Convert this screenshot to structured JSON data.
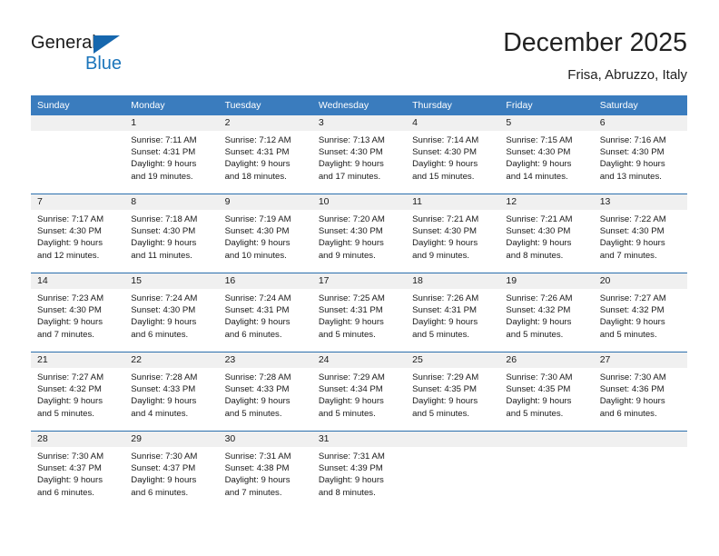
{
  "brand": {
    "name_part1": "General",
    "name_part2": "Blue",
    "triangle_color": "#1667ae",
    "blue_color": "#1b75bb"
  },
  "header": {
    "title": "December 2025",
    "subtitle": "Frisa, Abruzzo, Italy",
    "accent_color": "#3a7cbe",
    "separator_color": "#2a6ead",
    "daynum_band_color": "#f0f0f0"
  },
  "weekdays": [
    "Sunday",
    "Monday",
    "Tuesday",
    "Wednesday",
    "Thursday",
    "Friday",
    "Saturday"
  ],
  "weeks": [
    [
      {
        "day": "",
        "lines": []
      },
      {
        "day": "1",
        "lines": [
          "Sunrise: 7:11 AM",
          "Sunset: 4:31 PM",
          "Daylight: 9 hours",
          "and 19 minutes."
        ]
      },
      {
        "day": "2",
        "lines": [
          "Sunrise: 7:12 AM",
          "Sunset: 4:31 PM",
          "Daylight: 9 hours",
          "and 18 minutes."
        ]
      },
      {
        "day": "3",
        "lines": [
          "Sunrise: 7:13 AM",
          "Sunset: 4:30 PM",
          "Daylight: 9 hours",
          "and 17 minutes."
        ]
      },
      {
        "day": "4",
        "lines": [
          "Sunrise: 7:14 AM",
          "Sunset: 4:30 PM",
          "Daylight: 9 hours",
          "and 15 minutes."
        ]
      },
      {
        "day": "5",
        "lines": [
          "Sunrise: 7:15 AM",
          "Sunset: 4:30 PM",
          "Daylight: 9 hours",
          "and 14 minutes."
        ]
      },
      {
        "day": "6",
        "lines": [
          "Sunrise: 7:16 AM",
          "Sunset: 4:30 PM",
          "Daylight: 9 hours",
          "and 13 minutes."
        ]
      }
    ],
    [
      {
        "day": "7",
        "lines": [
          "Sunrise: 7:17 AM",
          "Sunset: 4:30 PM",
          "Daylight: 9 hours",
          "and 12 minutes."
        ]
      },
      {
        "day": "8",
        "lines": [
          "Sunrise: 7:18 AM",
          "Sunset: 4:30 PM",
          "Daylight: 9 hours",
          "and 11 minutes."
        ]
      },
      {
        "day": "9",
        "lines": [
          "Sunrise: 7:19 AM",
          "Sunset: 4:30 PM",
          "Daylight: 9 hours",
          "and 10 minutes."
        ]
      },
      {
        "day": "10",
        "lines": [
          "Sunrise: 7:20 AM",
          "Sunset: 4:30 PM",
          "Daylight: 9 hours",
          "and 9 minutes."
        ]
      },
      {
        "day": "11",
        "lines": [
          "Sunrise: 7:21 AM",
          "Sunset: 4:30 PM",
          "Daylight: 9 hours",
          "and 9 minutes."
        ]
      },
      {
        "day": "12",
        "lines": [
          "Sunrise: 7:21 AM",
          "Sunset: 4:30 PM",
          "Daylight: 9 hours",
          "and 8 minutes."
        ]
      },
      {
        "day": "13",
        "lines": [
          "Sunrise: 7:22 AM",
          "Sunset: 4:30 PM",
          "Daylight: 9 hours",
          "and 7 minutes."
        ]
      }
    ],
    [
      {
        "day": "14",
        "lines": [
          "Sunrise: 7:23 AM",
          "Sunset: 4:30 PM",
          "Daylight: 9 hours",
          "and 7 minutes."
        ]
      },
      {
        "day": "15",
        "lines": [
          "Sunrise: 7:24 AM",
          "Sunset: 4:30 PM",
          "Daylight: 9 hours",
          "and 6 minutes."
        ]
      },
      {
        "day": "16",
        "lines": [
          "Sunrise: 7:24 AM",
          "Sunset: 4:31 PM",
          "Daylight: 9 hours",
          "and 6 minutes."
        ]
      },
      {
        "day": "17",
        "lines": [
          "Sunrise: 7:25 AM",
          "Sunset: 4:31 PM",
          "Daylight: 9 hours",
          "and 5 minutes."
        ]
      },
      {
        "day": "18",
        "lines": [
          "Sunrise: 7:26 AM",
          "Sunset: 4:31 PM",
          "Daylight: 9 hours",
          "and 5 minutes."
        ]
      },
      {
        "day": "19",
        "lines": [
          "Sunrise: 7:26 AM",
          "Sunset: 4:32 PM",
          "Daylight: 9 hours",
          "and 5 minutes."
        ]
      },
      {
        "day": "20",
        "lines": [
          "Sunrise: 7:27 AM",
          "Sunset: 4:32 PM",
          "Daylight: 9 hours",
          "and 5 minutes."
        ]
      }
    ],
    [
      {
        "day": "21",
        "lines": [
          "Sunrise: 7:27 AM",
          "Sunset: 4:32 PM",
          "Daylight: 9 hours",
          "and 5 minutes."
        ]
      },
      {
        "day": "22",
        "lines": [
          "Sunrise: 7:28 AM",
          "Sunset: 4:33 PM",
          "Daylight: 9 hours",
          "and 4 minutes."
        ]
      },
      {
        "day": "23",
        "lines": [
          "Sunrise: 7:28 AM",
          "Sunset: 4:33 PM",
          "Daylight: 9 hours",
          "and 5 minutes."
        ]
      },
      {
        "day": "24",
        "lines": [
          "Sunrise: 7:29 AM",
          "Sunset: 4:34 PM",
          "Daylight: 9 hours",
          "and 5 minutes."
        ]
      },
      {
        "day": "25",
        "lines": [
          "Sunrise: 7:29 AM",
          "Sunset: 4:35 PM",
          "Daylight: 9 hours",
          "and 5 minutes."
        ]
      },
      {
        "day": "26",
        "lines": [
          "Sunrise: 7:30 AM",
          "Sunset: 4:35 PM",
          "Daylight: 9 hours",
          "and 5 minutes."
        ]
      },
      {
        "day": "27",
        "lines": [
          "Sunrise: 7:30 AM",
          "Sunset: 4:36 PM",
          "Daylight: 9 hours",
          "and 6 minutes."
        ]
      }
    ],
    [
      {
        "day": "28",
        "lines": [
          "Sunrise: 7:30 AM",
          "Sunset: 4:37 PM",
          "Daylight: 9 hours",
          "and 6 minutes."
        ]
      },
      {
        "day": "29",
        "lines": [
          "Sunrise: 7:30 AM",
          "Sunset: 4:37 PM",
          "Daylight: 9 hours",
          "and 6 minutes."
        ]
      },
      {
        "day": "30",
        "lines": [
          "Sunrise: 7:31 AM",
          "Sunset: 4:38 PM",
          "Daylight: 9 hours",
          "and 7 minutes."
        ]
      },
      {
        "day": "31",
        "lines": [
          "Sunrise: 7:31 AM",
          "Sunset: 4:39 PM",
          "Daylight: 9 hours",
          "and 8 minutes."
        ]
      },
      {
        "day": "",
        "lines": []
      },
      {
        "day": "",
        "lines": []
      },
      {
        "day": "",
        "lines": []
      }
    ]
  ]
}
